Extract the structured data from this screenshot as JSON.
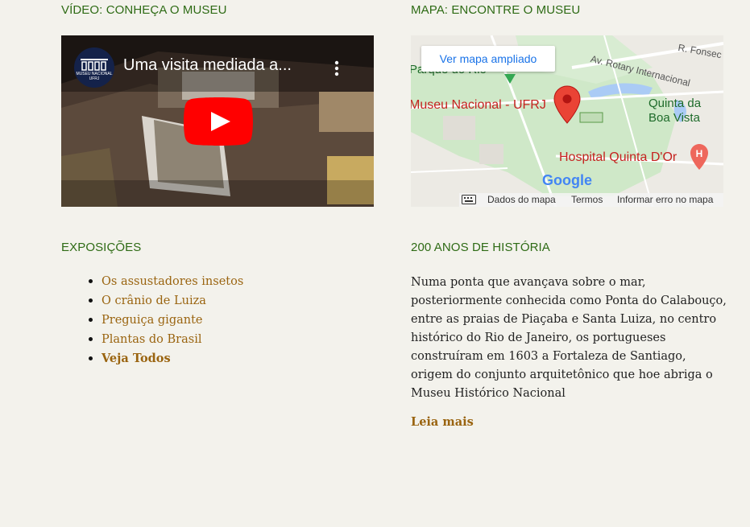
{
  "video_section": {
    "heading": "VÍDEO: CONHEÇA O MUSEU",
    "video_title": "Uma visita mediada a...",
    "channel_logo_text": "MUSEU NACIONAL UFRJ"
  },
  "map_section": {
    "heading": "MAPA: ENCONTRE O MUSEU",
    "view_larger": "Ver mapa ampliado",
    "labels": {
      "parque": "Parque do Rio",
      "museu": "Museu Nacional - UFRJ",
      "quinta": "Quinta da",
      "boa_vista": "Boa Vista",
      "hospital": "Hospital Quinta D'Or",
      "rotary": "Av. Rotary Internacional",
      "fonseca": "R. Fonsec",
      "google": "Google"
    },
    "footer": {
      "data": "Dados do mapa",
      "terms": "Termos",
      "report": "Informar erro no mapa"
    }
  },
  "exhibitions": {
    "heading": "EXPOSIÇÕES",
    "items": [
      "Os assustadores insetos",
      "O crânio de Luiza",
      "Preguiça gigante",
      "Plantas do Brasil"
    ],
    "see_all": "Veja Todos"
  },
  "history": {
    "heading": "200 ANOS DE HISTÓRIA",
    "text": "Numa ponta que avançava sobre o mar, posteriormente conhecida como Ponta do Calabouço, entre as praias de Piaçaba e Santa Luiza, no centro histórico do Rio de Janeiro, os portugueses construíram em 1603 a Fortaleza de Santiago, origem do conjunto arquitetônico que hoe abriga o Museu Histórico Nacional",
    "read_more": "Leia mais"
  },
  "colors": {
    "heading": "#2e6b15",
    "link": "#9a6410",
    "background": "#f3f2ec",
    "youtube_red": "#ff0000"
  }
}
